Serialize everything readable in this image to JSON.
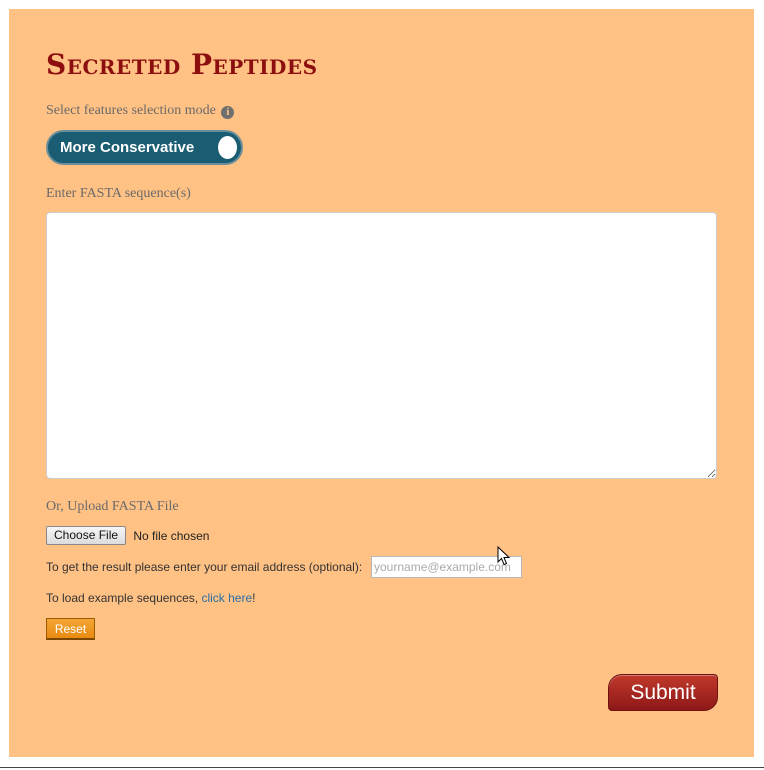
{
  "header": {
    "title": "Secreted Peptides"
  },
  "mode": {
    "label": "Select features selection mode",
    "toggle_label": "More Conservative",
    "info_icon": "i"
  },
  "fasta": {
    "label": "Enter FASTA sequence(s)",
    "value": ""
  },
  "upload": {
    "label": "Or, Upload FASTA File",
    "button_label": "Choose File",
    "status": "No file chosen"
  },
  "email": {
    "prompt": "To get the result please enter your email address (optional):",
    "placeholder": "yourname@example.com",
    "value": ""
  },
  "example": {
    "prompt": "To load example sequences, ",
    "link_text": "click here",
    "suffix": "!"
  },
  "buttons": {
    "reset_label": "Reset",
    "submit_label": "Submit"
  },
  "colors": {
    "panel_background": "#ffc184",
    "title": "#8c0e0e",
    "toggle": "#1a5d73",
    "reset": "#e88b10",
    "submit": "#a82323",
    "link": "#2a6fa8"
  },
  "icons": {
    "info": "info-circle-icon",
    "cursor": "mouse-pointer-icon"
  }
}
